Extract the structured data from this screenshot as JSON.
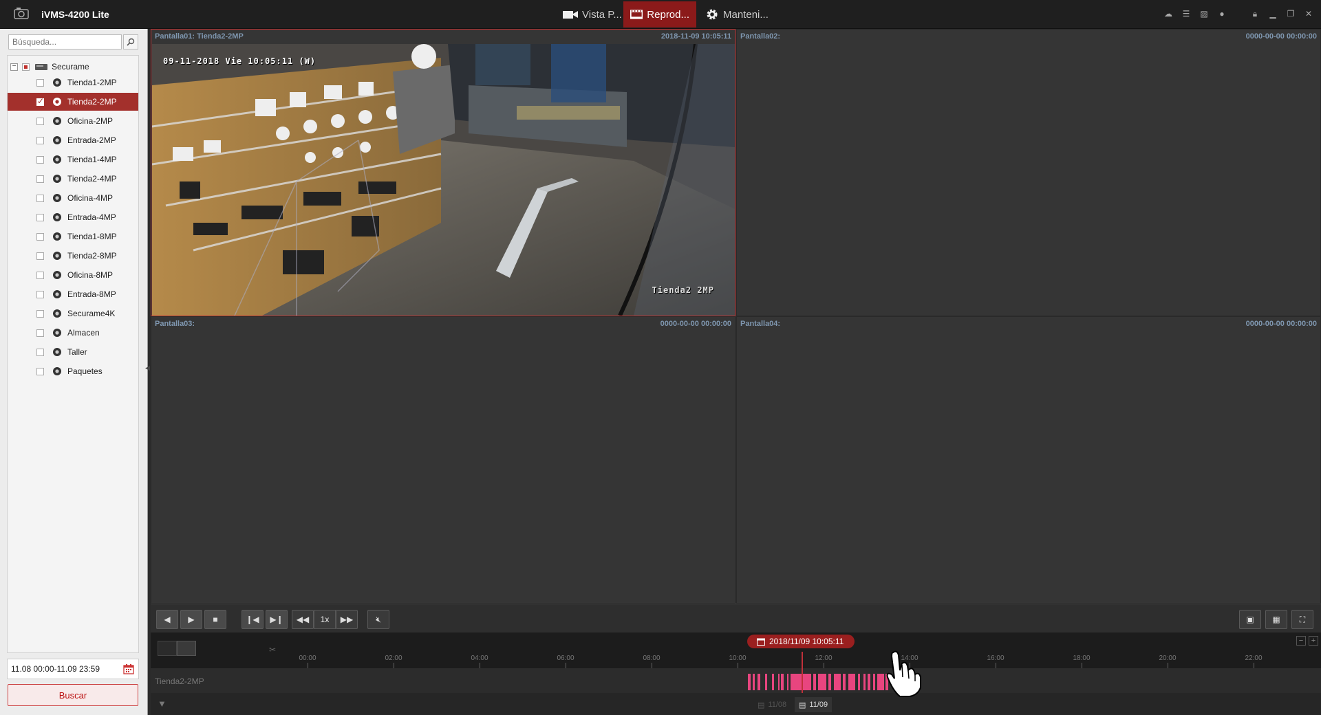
{
  "app": {
    "title": "iVMS-4200 Lite"
  },
  "nav": {
    "tabs": [
      {
        "label": "Vista P..."
      },
      {
        "label": "Reprod..."
      },
      {
        "label": "Manteni..."
      }
    ]
  },
  "sidebar": {
    "search_placeholder": "Búsqueda...",
    "root_label": "Securame",
    "items": [
      {
        "label": "Tienda1-2MP",
        "checked": false
      },
      {
        "label": "Tienda2-2MP",
        "checked": true
      },
      {
        "label": "Oficina-2MP",
        "checked": false
      },
      {
        "label": "Entrada-2MP",
        "checked": false
      },
      {
        "label": "Tienda1-4MP",
        "checked": false
      },
      {
        "label": "Tienda2-4MP",
        "checked": false
      },
      {
        "label": "Oficina-4MP",
        "checked": false
      },
      {
        "label": "Entrada-4MP",
        "checked": false
      },
      {
        "label": "Tienda1-8MP",
        "checked": false
      },
      {
        "label": "Tienda2-8MP",
        "checked": false
      },
      {
        "label": "Oficina-8MP",
        "checked": false
      },
      {
        "label": "Entrada-8MP",
        "checked": false
      },
      {
        "label": "Securame4K",
        "checked": false
      },
      {
        "label": "Almacen",
        "checked": false
      },
      {
        "label": "Taller",
        "checked": false
      },
      {
        "label": "Paquetes",
        "checked": false
      }
    ],
    "time_range": "11.08 00:00-11.09 23:59",
    "search_button": "Buscar"
  },
  "panes": [
    {
      "title": "Pantalla01: Tienda2-2MP",
      "time": "2018-11-09 10:05:11"
    },
    {
      "title": "Pantalla02:",
      "time": "0000-00-00 00:00:00"
    },
    {
      "title": "Pantalla03:",
      "time": "0000-00-00 00:00:00"
    },
    {
      "title": "Pantalla04:",
      "time": "0000-00-00 00:00:00"
    }
  ],
  "osd": {
    "datetime": "09-11-2018 Vie 10:05:11 (W)",
    "camera": "Tienda2 2MP"
  },
  "controls": {
    "speed": "1x"
  },
  "timeline": {
    "current": "2018/11/09 10:05:11",
    "ticks": [
      "00:00",
      "02:00",
      "04:00",
      "06:00",
      "08:00",
      "10:00",
      "12:00",
      "14:00",
      "16:00",
      "18:00",
      "20:00",
      "22:00"
    ],
    "track_name": "Tienda2-2MP",
    "day_prev": "11/08",
    "day_current": "11/09"
  },
  "colors": {
    "accent": "#8b1a1a",
    "recording": "#e8457f"
  }
}
